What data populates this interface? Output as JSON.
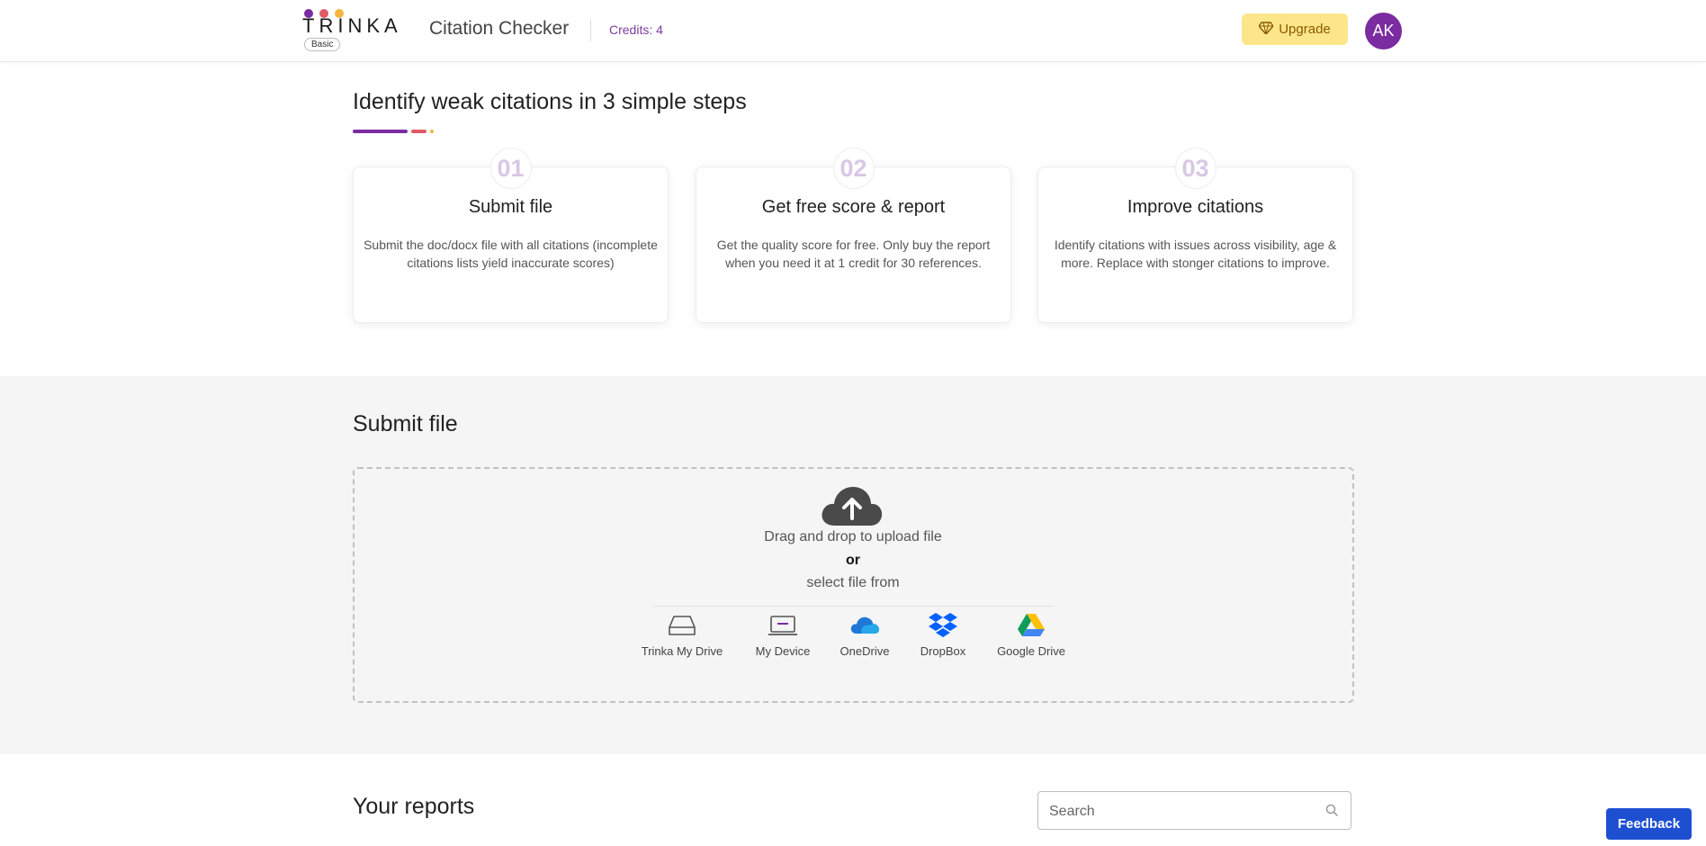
{
  "header": {
    "logo_text": "TRINKA",
    "plan_badge": "Basic",
    "app_title": "Citation Checker",
    "credits": "Credits: 4",
    "upgrade_label": "Upgrade",
    "avatar_initials": "AK",
    "logo_dot_colors": [
      "#7b2ca0",
      "#e05a67",
      "#f5b63f"
    ]
  },
  "steps": {
    "title": "Identify weak citations in 3 simple steps",
    "title_bar_colors": [
      "#7b2ca0",
      "#e05a67",
      "#f5b63f"
    ],
    "cards": [
      {
        "number": "01",
        "title": "Submit file",
        "description": "Submit the doc/docx file with all citations (incomplete citations lists yield inaccurate scores)"
      },
      {
        "number": "02",
        "title": "Get free score & report",
        "description": "Get the quality score for free. Only buy the report when you need it at 1 credit for 30 references."
      },
      {
        "number": "03",
        "title": "Improve citations",
        "description": "Identify citations with issues across visibility, age & more. Replace with stonger citations to improve."
      }
    ]
  },
  "submit": {
    "title": "Submit file",
    "drag_text": "Drag and drop to upload file",
    "or_text": "or",
    "select_text": "select file from",
    "sources": [
      {
        "label": "Trinka My Drive",
        "icon": "drive-icon"
      },
      {
        "label": "My Device",
        "icon": "laptop-icon"
      },
      {
        "label": "OneDrive",
        "icon": "onedrive-icon"
      },
      {
        "label": "DropBox",
        "icon": "dropbox-icon"
      },
      {
        "label": "Google Drive",
        "icon": "google-drive-icon"
      }
    ]
  },
  "reports": {
    "title": "Your reports",
    "search_placeholder": "Search"
  },
  "feedback_label": "Feedback",
  "colors": {
    "brand_purple": "#7b2ca0",
    "upgrade_bg": "#fde68a",
    "feedback_bg": "#1f4fd1"
  }
}
